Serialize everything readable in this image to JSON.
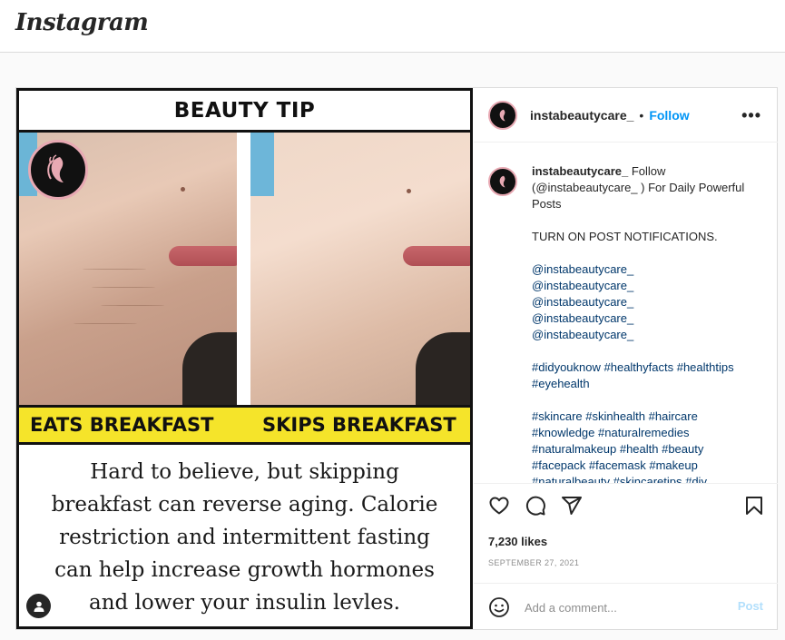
{
  "topbar": {
    "logo": "Instagram"
  },
  "media": {
    "title": "BEAUTY TIP",
    "left_label": "EATS BREAKFAST",
    "right_label": "SKIPS BREAKFAST",
    "body": "Hard to believe, but skipping breakfast can reverse aging. Calorie restriction and intermittent fasting can help increase growth hormones and lower your insulin levles."
  },
  "header": {
    "username": "instabeautycare_",
    "separator": "•",
    "follow_label": "Follow",
    "more_label": "•••"
  },
  "caption": {
    "username": "instabeautycare_",
    "text_1": "Follow (@instabeautycare_ ) For Daily Powerful Posts",
    "text_2": "TURN ON POST NOTIFICATIONS.",
    "mentions": [
      "@instabeautycare_",
      "@instabeautycare_",
      "@instabeautycare_",
      "@instabeautycare_",
      "@instabeautycare_"
    ],
    "hashtags_1": "#didyouknow #healthyfacts #healthtips #eyehealth",
    "hashtags_2": "#skincare #skinhealth #haircare #knowledge #naturalremedies #naturalmakeup #health #beauty #facepack #facemask #makeup",
    "hashtags_3": "#naturalbeauty #skincaretips #diy"
  },
  "actions": {
    "likes": "7,230 likes",
    "date": "SEPTEMBER 27, 2021",
    "comment_placeholder": "Add a comment...",
    "post_label": "Post"
  },
  "icons": [
    "heart-icon",
    "comment-icon",
    "share-icon",
    "bookmark-icon",
    "emoji-icon",
    "more-icon",
    "user-tag-icon"
  ],
  "colors": {
    "accent": "#0095f6",
    "link": "#00376b",
    "post_disabled": "#b2dffc",
    "banner_yellow": "#f5e42a",
    "badge_border": "#e8a9b3"
  }
}
